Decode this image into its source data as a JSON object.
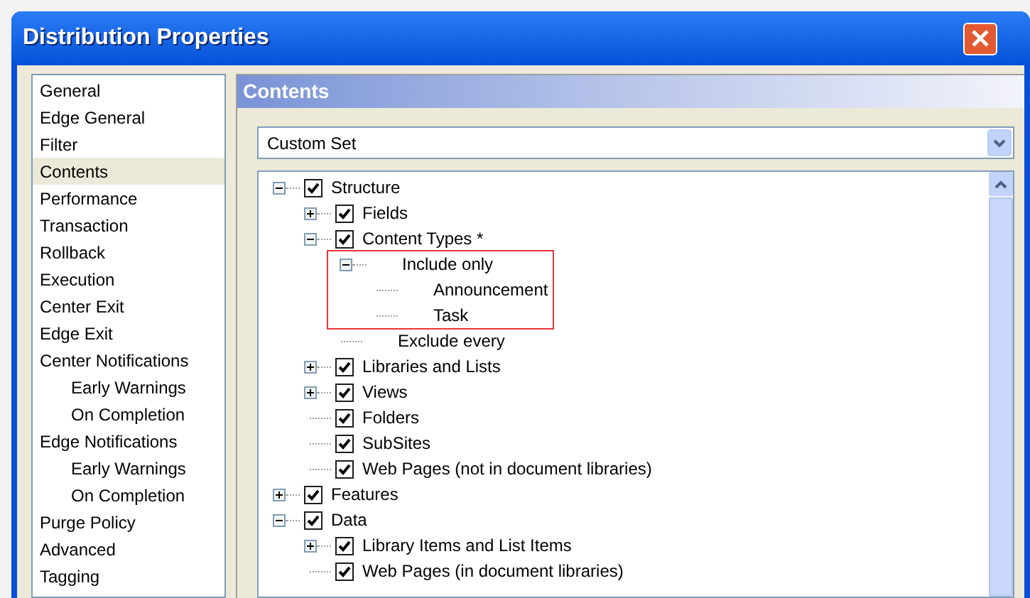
{
  "window": {
    "title": "Distribution Properties"
  },
  "sidebar": {
    "items": [
      {
        "label": "General",
        "selected": false
      },
      {
        "label": "Edge General",
        "selected": false
      },
      {
        "label": "Filter",
        "selected": false
      },
      {
        "label": "Contents",
        "selected": true
      },
      {
        "label": "Performance",
        "selected": false
      },
      {
        "label": "Transaction",
        "selected": false
      },
      {
        "label": "Rollback",
        "selected": false
      },
      {
        "label": "Execution",
        "selected": false
      },
      {
        "label": "Center Exit",
        "selected": false
      },
      {
        "label": "Edge Exit",
        "selected": false
      },
      {
        "label": "Center Notifications",
        "selected": false,
        "children": [
          {
            "label": "Early Warnings",
            "selected": false
          },
          {
            "label": "On Completion",
            "selected": false
          }
        ]
      },
      {
        "label": "Edge Notifications",
        "selected": false,
        "children": [
          {
            "label": "Early Warnings",
            "selected": false
          },
          {
            "label": "On Completion",
            "selected": false
          }
        ]
      },
      {
        "label": "Purge Policy",
        "selected": false
      },
      {
        "label": "Advanced",
        "selected": false
      },
      {
        "label": "Tagging",
        "selected": false
      }
    ]
  },
  "panel": {
    "title": "Contents",
    "dropdown": {
      "value": "Custom Set"
    },
    "tree": [
      {
        "label": "Structure",
        "expanded": true,
        "checked": true,
        "children": [
          {
            "label": "Fields",
            "expanded": false,
            "checked": true
          },
          {
            "label": "Content Types *",
            "expanded": true,
            "checked": true,
            "children": [
              {
                "label": "Include only",
                "expanded": true,
                "highlighted": true,
                "children": [
                  {
                    "label": "Announcement"
                  },
                  {
                    "label": "Task"
                  }
                ]
              },
              {
                "label": "Exclude every"
              }
            ]
          },
          {
            "label": "Libraries and Lists",
            "expanded": false,
            "checked": true
          },
          {
            "label": "Views",
            "expanded": false,
            "checked": true
          },
          {
            "label": "Folders",
            "checked": true
          },
          {
            "label": "SubSites",
            "checked": true
          },
          {
            "label": "Web Pages (not in document libraries)",
            "checked": true
          }
        ]
      },
      {
        "label": "Features",
        "expanded": false,
        "checked": true
      },
      {
        "label": "Data",
        "expanded": true,
        "checked": true,
        "children": [
          {
            "label": "Library Items and List Items",
            "expanded": false,
            "checked": true
          },
          {
            "label": "Web Pages (in document libraries)",
            "checked": true
          }
        ]
      }
    ]
  }
}
